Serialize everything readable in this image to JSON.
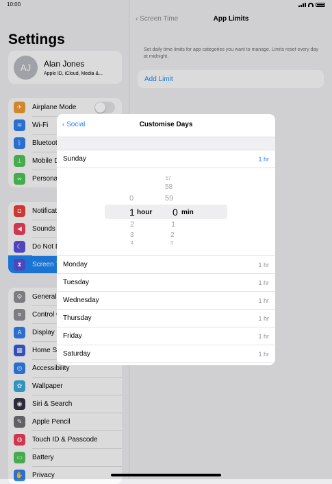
{
  "status": {
    "time": "10:00"
  },
  "sidebar": {
    "title": "Settings",
    "account": {
      "initials": "AJ",
      "name": "Alan Jones",
      "subtitle": "Apple ID, iCloud, Media &..."
    },
    "groups": [
      [
        {
          "label": "Airplane Mode",
          "icon": "airplane-icon",
          "color": "#f0992f",
          "toggle": true
        },
        {
          "label": "Wi-Fi",
          "icon": "wifi-icon",
          "color": "#2f7ff0"
        },
        {
          "label": "Bluetooth",
          "icon": "bluetooth-icon",
          "color": "#2f7ff0"
        },
        {
          "label": "Mobile Data",
          "icon": "antenna-icon",
          "color": "#4fc458"
        },
        {
          "label": "Personal Hotspot",
          "icon": "link-icon",
          "color": "#4fc458"
        }
      ],
      [
        {
          "label": "Notifications",
          "icon": "bell-icon",
          "color": "#ee3e37"
        },
        {
          "label": "Sounds",
          "icon": "speaker-icon",
          "color": "#ee3e5c"
        },
        {
          "label": "Do Not Disturb",
          "icon": "moon-icon",
          "color": "#5b4fd7"
        },
        {
          "label": "Screen Time",
          "icon": "hourglass-icon",
          "color": "#5b4fd7",
          "selected": true
        }
      ],
      [
        {
          "label": "General",
          "icon": "gear-icon",
          "color": "#8e8e93"
        },
        {
          "label": "Control Centre",
          "icon": "switches-icon",
          "color": "#8e8e93"
        },
        {
          "label": "Display & Brightness",
          "icon": "text-size-icon",
          "color": "#2f7ff0"
        },
        {
          "label": "Home Screen & Dock",
          "icon": "grid-icon",
          "color": "#3b5bd6"
        },
        {
          "label": "Accessibility",
          "icon": "person-circle-icon",
          "color": "#2f7ff0"
        },
        {
          "label": "Wallpaper",
          "icon": "flower-icon",
          "color": "#37aadc"
        },
        {
          "label": "Siri & Search",
          "icon": "siri-icon",
          "color": "#333344"
        },
        {
          "label": "Apple Pencil",
          "icon": "pencil-icon",
          "color": "#6e6e73"
        },
        {
          "label": "Touch ID & Passcode",
          "icon": "fingerprint-icon",
          "color": "#ee3e5c"
        },
        {
          "label": "Battery",
          "icon": "battery-icon",
          "color": "#4fc458"
        },
        {
          "label": "Privacy",
          "icon": "hand-icon",
          "color": "#2f7ff0"
        }
      ]
    ]
  },
  "detail": {
    "back": "Screen Time",
    "title": "App Limits",
    "description": "Set daily time limits for app categories you want to manage. Limits reset every day at midnight.",
    "add_limit": "Add Limit"
  },
  "modal": {
    "back": "Social",
    "title": "Customise Days",
    "first_day": {
      "label": "Sunday",
      "value": "1 hr"
    },
    "picker": {
      "hours_above": [
        "0"
      ],
      "hours_selected": "1",
      "hours_below": [
        "2",
        "3",
        "4"
      ],
      "hours_unit": "hour",
      "mins_above": [
        "57",
        "58",
        "59"
      ],
      "mins_selected": "0",
      "mins_below": [
        "1",
        "2",
        "3"
      ],
      "mins_unit": "min"
    },
    "days": [
      {
        "label": "Monday",
        "value": "1 hr"
      },
      {
        "label": "Tuesday",
        "value": "1 hr"
      },
      {
        "label": "Wednesday",
        "value": "1 hr"
      },
      {
        "label": "Thursday",
        "value": "1 hr"
      },
      {
        "label": "Friday",
        "value": "1 hr"
      },
      {
        "label": "Saturday",
        "value": "1 hr"
      }
    ]
  }
}
